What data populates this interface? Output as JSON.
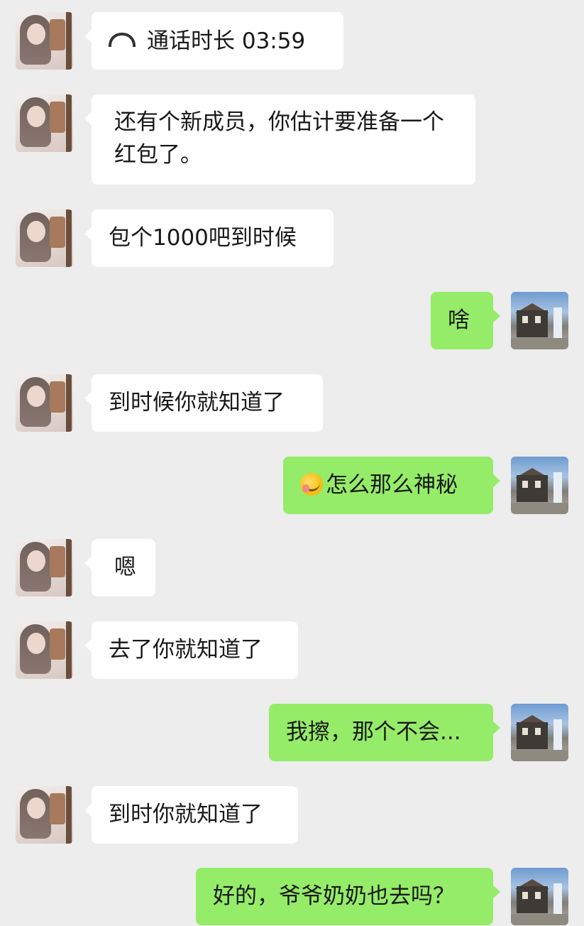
{
  "messages": [
    {
      "side": "in",
      "avatar": "girl-avatar",
      "text": "通话时长 03:59",
      "icon": "phone-call-icon"
    },
    {
      "side": "in",
      "avatar": "girl-avatar",
      "text": "还有个新成员，你估计要准备一个红包了。"
    },
    {
      "side": "in",
      "avatar": "girl-avatar",
      "text": "包个1000吧到时候"
    },
    {
      "side": "out",
      "avatar": "street-avatar",
      "text": "啥"
    },
    {
      "side": "in",
      "avatar": "girl-avatar",
      "text": "到时候你就知道了"
    },
    {
      "side": "out",
      "avatar": "street-avatar",
      "text": "怎么那么神秘",
      "icon": "facepalm-emoji-icon"
    },
    {
      "side": "in",
      "avatar": "girl-avatar",
      "text": "嗯"
    },
    {
      "side": "in",
      "avatar": "girl-avatar",
      "text": "去了你就知道了"
    },
    {
      "side": "out",
      "avatar": "street-avatar",
      "text": "我擦，那个不会..."
    },
    {
      "side": "in",
      "avatar": "girl-avatar",
      "text": "到时你就知道了"
    },
    {
      "side": "out",
      "avatar": "street-avatar",
      "text": "好的，爷爷奶奶也去吗？"
    }
  ],
  "colors": {
    "background": "#ededed",
    "incoming_bubble": "#ffffff",
    "outgoing_bubble": "#95ec69",
    "text": "#191919"
  }
}
